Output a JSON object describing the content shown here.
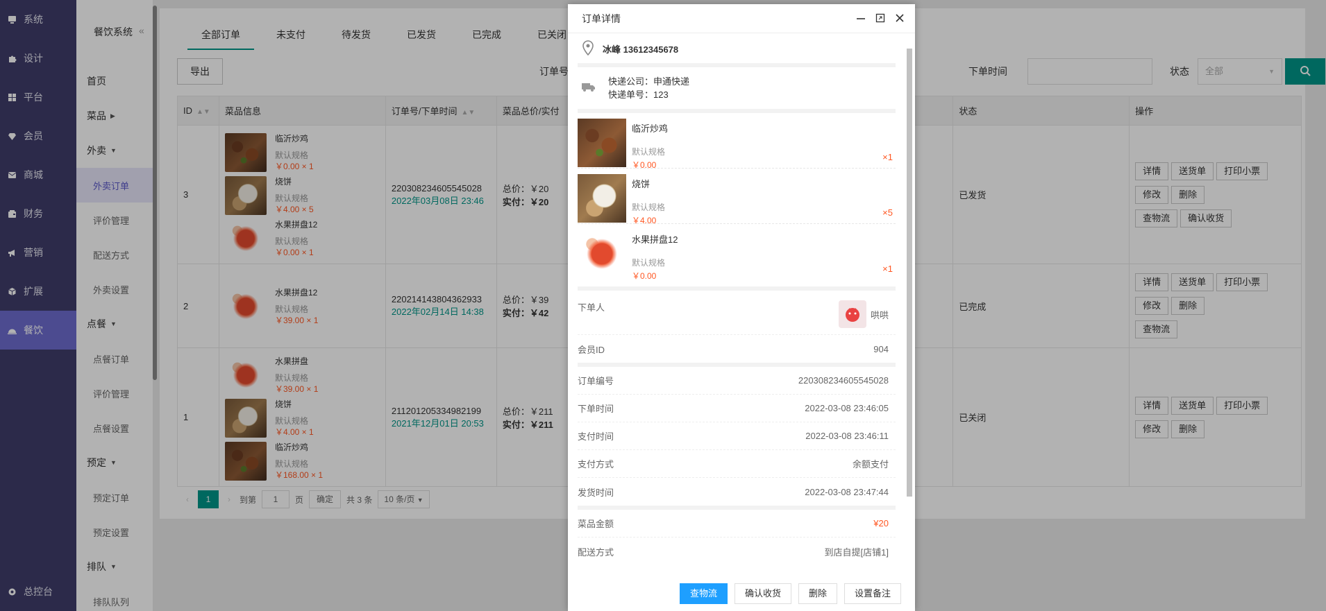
{
  "nav": {
    "items": [
      {
        "label": "系统",
        "icon": "computer-icon"
      },
      {
        "label": "设计",
        "icon": "puzzle-icon"
      },
      {
        "label": "平台",
        "icon": "grid-icon"
      },
      {
        "label": "会员",
        "icon": "diamond-icon"
      },
      {
        "label": "商城",
        "icon": "mail-icon"
      },
      {
        "label": "财务",
        "icon": "wallet-icon"
      },
      {
        "label": "营销",
        "icon": "megaphone-icon"
      },
      {
        "label": "扩展",
        "icon": "cube-icon"
      },
      {
        "label": "餐饮",
        "icon": "cloche-icon"
      }
    ],
    "bottom": "总控台"
  },
  "subnav": {
    "title": "餐饮系统",
    "collapse": "«",
    "items": [
      "首页",
      "菜品",
      "外卖",
      "外卖订单",
      "评价管理",
      "配送方式",
      "外卖设置",
      "点餐",
      "点餐订单",
      "评价管理",
      "点餐设置",
      "预定",
      "预定订单",
      "预定设置",
      "排队",
      "排队队列"
    ]
  },
  "tabs": [
    "全部订单",
    "未支付",
    "待发货",
    "已发货",
    "已完成",
    "已关闭"
  ],
  "toolbar": {
    "export": "导出",
    "order_no_label": "订单号",
    "order_time_label": "下单时间",
    "status_label": "状态",
    "status_value": "全部"
  },
  "table": {
    "headers": [
      "ID",
      "菜品信息",
      "订单号/下单时间",
      "菜品总价/实付",
      "状态",
      "操作"
    ],
    "rows": [
      {
        "id": "3",
        "items": [
          {
            "name": "临沂炒鸡",
            "spec": "默认规格",
            "price": "￥0.00 × 1"
          },
          {
            "name": "烧饼",
            "spec": "默认规格",
            "price": "￥4.00 × 5"
          },
          {
            "name": "水果拼盘12",
            "spec": "默认规格",
            "price": "￥0.00 × 1"
          }
        ],
        "order_no": "220308234605545028",
        "order_time": "2022年03月08日 23:46",
        "total": "总价：￥20",
        "paid_label": "实付：",
        "paid": "￥20",
        "status": "已发货",
        "ops": [
          "详情",
          "送货单",
          "打印小票",
          "修改",
          "删除",
          "查物流",
          "确认收货"
        ]
      },
      {
        "id": "2",
        "items": [
          {
            "name": "水果拼盘12",
            "spec": "默认规格",
            "price": "￥39.00 × 1"
          }
        ],
        "order_no": "220214143804362933",
        "order_time": "2022年02月14日 14:38",
        "total": "总价：￥39",
        "paid_label": "实付：",
        "paid": "￥42",
        "status": "已完成",
        "ops": [
          "详情",
          "送货单",
          "打印小票",
          "修改",
          "删除",
          "查物流"
        ]
      },
      {
        "id": "1",
        "items": [
          {
            "name": "水果拼盘",
            "spec": "默认规格",
            "price": "￥39.00 × 1"
          },
          {
            "name": "烧饼",
            "spec": "默认规格",
            "price": "￥4.00 × 1"
          },
          {
            "name": "临沂炒鸡",
            "spec": "默认规格",
            "price": "￥168.00 × 1"
          }
        ],
        "order_no": "211201205334982199",
        "order_time": "2021年12月01日 20:53",
        "total": "总价：￥211",
        "paid_label": "实付：",
        "paid": "￥211",
        "status": "已关闭",
        "ops": [
          "详情",
          "送货单",
          "打印小票",
          "修改",
          "删除"
        ]
      }
    ]
  },
  "pager": {
    "current": "1",
    "goto_label": "到第",
    "goto_value": "1",
    "page_unit": "页",
    "confirm": "确定",
    "total": "共 3 条",
    "per_page": "10 条/页"
  },
  "modal": {
    "title": "订单详情",
    "receiver": "冰峰 13612345678",
    "courier_label": "快递公司：",
    "courier": "申通快递",
    "tracking_label": "快递单号：",
    "tracking": "123",
    "products": [
      {
        "name": "临沂炒鸡",
        "spec": "默认规格",
        "price": "￥0.00",
        "qty": "×1"
      },
      {
        "name": "烧饼",
        "spec": "默认规格",
        "price": "￥4.00",
        "qty": "×5"
      },
      {
        "name": "水果拼盘12",
        "spec": "默认规格",
        "price": "￥0.00",
        "qty": "×1"
      }
    ],
    "buyer_label": "下单人",
    "buyer_name": "哄哄",
    "member_id_label": "会员ID",
    "member_id": "904",
    "order_no_label": "订单编号",
    "order_no": "220308234605545028",
    "order_time_label": "下单时间",
    "order_time": "2022-03-08 23:46:05",
    "pay_time_label": "支付时间",
    "pay_time": "2022-03-08 23:46:11",
    "pay_method_label": "支付方式",
    "pay_method": "余额支付",
    "ship_time_label": "发货时间",
    "ship_time": "2022-03-08 23:47:44",
    "amount_label": "菜品金额",
    "amount": "¥20",
    "delivery_label": "配送方式",
    "delivery": "到店自提[店铺1]",
    "buttons": [
      "查物流",
      "确认收货",
      "删除",
      "设置备注"
    ]
  }
}
